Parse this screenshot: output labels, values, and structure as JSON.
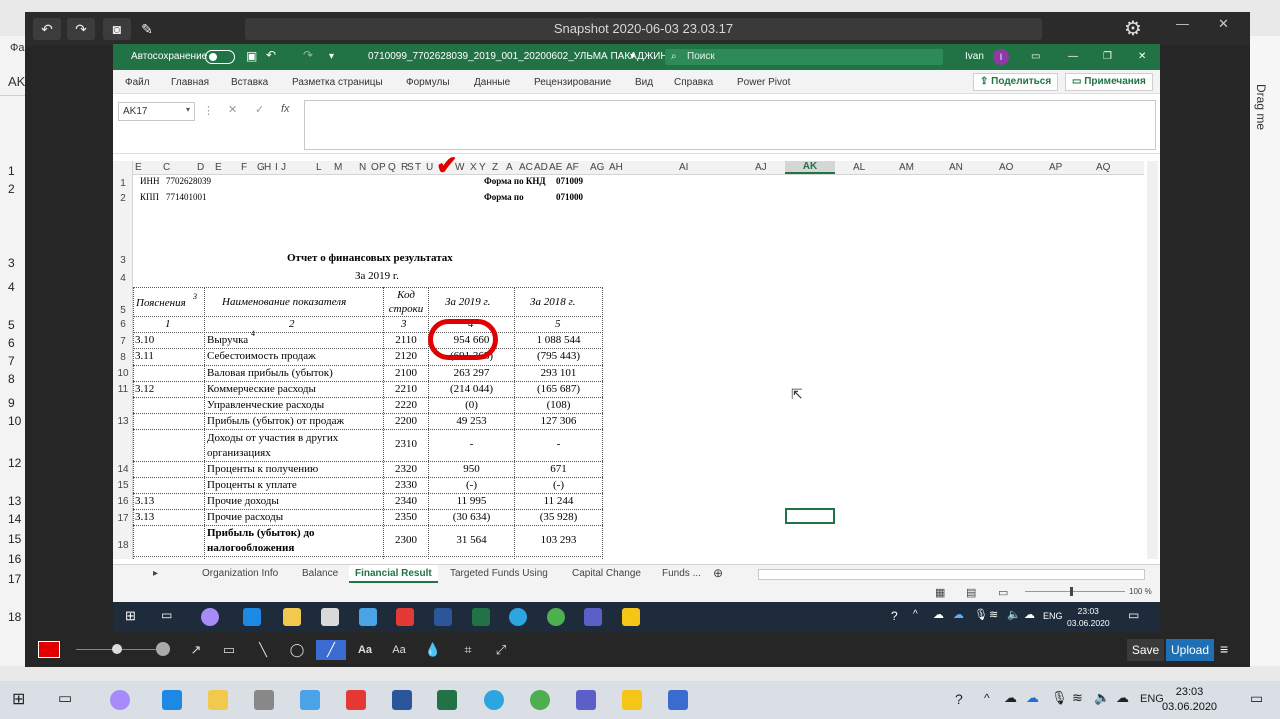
{
  "snapshot": {
    "title": "Snapshot 2020-06-03 23.03.17",
    "save_label": "Save",
    "upload_label": "Upload",
    "drag_label": "Drag me",
    "tool_text_label": "Aa",
    "tool_text2_label": "Aa"
  },
  "excel": {
    "autosave_label": "Автосохранение",
    "filename": "0710099_7702628039_2019_001_20200602_УЛЬМА ПАКАДЖИНГ",
    "search_placeholder": "Поиск",
    "user_name": "Ivan",
    "user_initial": "I",
    "menu": [
      "Файл",
      "Главная",
      "Вставка",
      "Разметка страницы",
      "Формулы",
      "Данные",
      "Рецензирование",
      "Вид",
      "Справка",
      "Power Pivot"
    ],
    "share_label": "Поделиться",
    "notes_label": "Примечания",
    "name_box": "AK17",
    "formula_fx": "fx",
    "columns_left": [
      "E",
      "C",
      "D",
      "E",
      "F",
      "G",
      "H",
      "I",
      "J",
      "L",
      "M",
      "N",
      "O",
      "P",
      "Q",
      "R",
      "S",
      "T",
      "U",
      "V",
      "W",
      "X",
      "Y",
      "Z",
      "A",
      "AC",
      "AD",
      "AE",
      "AF",
      "AG",
      "AH"
    ],
    "columns_right": [
      "AI",
      "AJ",
      "AK",
      "AL",
      "AM",
      "AN",
      "AO",
      "AP",
      "AQ"
    ],
    "rows": [
      "1",
      "2",
      "3",
      "4",
      "5",
      "6",
      "7",
      "8",
      "9",
      "10",
      "11",
      "12",
      "13",
      "14",
      "15",
      "16",
      "17",
      "18"
    ],
    "sheet": {
      "inn_label": "ИНН",
      "inn": "7702628039",
      "kpp_label": "КПП",
      "kpp": "771401001",
      "form_knd_label": "Форма по КНД",
      "form_knd": "071009",
      "form_po_label": "Форма по",
      "form_po": "071000",
      "title": "Отчет о финансовых результатах",
      "year": "За 2019 г.",
      "hdr_notes": "Пояснения",
      "hdr_notes_sup": "3",
      "hdr_name": "Наименование показателя",
      "hdr_code": "Код строки",
      "hdr_2019": "За 2019 г.",
      "hdr_2018": "За 2018 г.",
      "num_1": "1",
      "num_2": "2",
      "num_3": "3",
      "num_4": "4",
      "num_5": "5",
      "lines": [
        {
          "note": "3.10",
          "name": "Выручка",
          "sup": "4",
          "code": "2110",
          "v2019": "954 660",
          "v2018": "1 088 544"
        },
        {
          "note": "3.11",
          "name": "Себестоимость продаж",
          "sup": "",
          "code": "2120",
          "v2019": "(691 363)",
          "v2018": "(795 443)"
        },
        {
          "note": "",
          "name": "Валовая прибыль (убыток)",
          "sup": "",
          "code": "2100",
          "v2019": "263 297",
          "v2018": "293 101"
        },
        {
          "note": "3.12",
          "name": "Коммерческие расходы",
          "sup": "",
          "code": "2210",
          "v2019": "(214 044)",
          "v2018": "(165 687)"
        },
        {
          "note": "",
          "name": "Управленческие расходы",
          "sup": "",
          "code": "2220",
          "v2019": "(0)",
          "v2018": "(108)"
        },
        {
          "note": "",
          "name": "Прибыль (убыток) от продаж",
          "sup": "",
          "code": "2200",
          "v2019": "49 253",
          "v2018": "127 306"
        },
        {
          "note": "",
          "name": "Доходы от участия в других организациях",
          "sup": "",
          "code": "2310",
          "v2019": "-",
          "v2018": "-"
        },
        {
          "note": "",
          "name": "Проценты к получению",
          "sup": "",
          "code": "2320",
          "v2019": "950",
          "v2018": "671"
        },
        {
          "note": "",
          "name": "Проценты к уплате",
          "sup": "",
          "code": "2330",
          "v2019": "(-)",
          "v2018": "(-)"
        },
        {
          "note": "3.13",
          "name": "Прочие доходы",
          "sup": "",
          "code": "2340",
          "v2019": "11 995",
          "v2018": "11 244"
        },
        {
          "note": "3.13",
          "name": "Прочие расходы",
          "sup": "",
          "code": "2350",
          "v2019": "(30 634)",
          "v2018": "(35 928)"
        },
        {
          "note": "",
          "name": "Прибыль (убыток) до налогообложения",
          "sup": "",
          "code": "2300",
          "v2019": "31 564",
          "v2018": "103 293"
        }
      ],
      "inner_rows": [
        "1",
        "2",
        "3",
        "4",
        "5",
        "6",
        "7",
        "8",
        "9",
        "10",
        "11",
        "12",
        "13",
        "14",
        "15",
        "16",
        "17",
        "18"
      ]
    },
    "tabs": [
      "Organization Info",
      "Balance",
      "Financial Result",
      "Targeted Funds Using",
      "Capital Change",
      "Funds ..."
    ],
    "zoom": "100 %"
  },
  "inner_taskbar": {
    "lang": "ENG",
    "time": "23:03",
    "date": "03.06.2020"
  },
  "outer_taskbar": {
    "lang": "ENG",
    "time": "23:03",
    "date": "03.06.2020"
  }
}
